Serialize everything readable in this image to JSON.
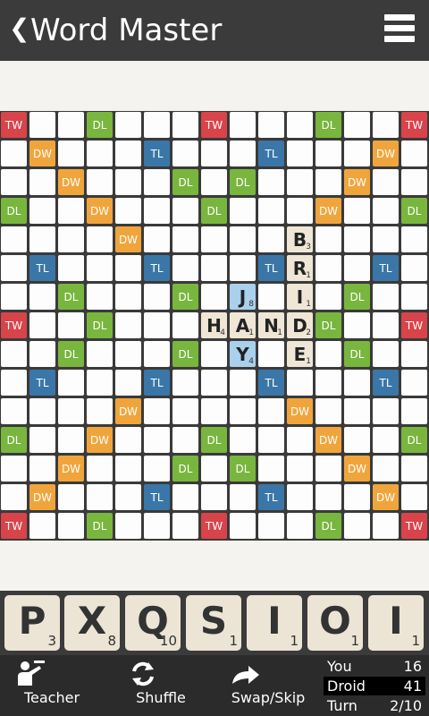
{
  "header": {
    "back_glyph": "❮",
    "title": "Word Master",
    "menu_icon": "hamburger-icon"
  },
  "board": {
    "size": 15,
    "premiums": {
      "TW": [
        [
          0,
          0
        ],
        [
          0,
          7
        ],
        [
          0,
          14
        ],
        [
          7,
          0
        ],
        [
          7,
          14
        ],
        [
          14,
          0
        ],
        [
          14,
          7
        ],
        [
          14,
          14
        ]
      ],
      "DW": [
        [
          1,
          1
        ],
        [
          1,
          13
        ],
        [
          2,
          2
        ],
        [
          2,
          12
        ],
        [
          3,
          3
        ],
        [
          3,
          11
        ],
        [
          4,
          4
        ],
        [
          4,
          10
        ],
        [
          10,
          4
        ],
        [
          10,
          10
        ],
        [
          11,
          3
        ],
        [
          11,
          11
        ],
        [
          12,
          2
        ],
        [
          12,
          12
        ],
        [
          13,
          1
        ],
        [
          13,
          13
        ]
      ],
      "DL": [
        [
          0,
          3
        ],
        [
          0,
          11
        ],
        [
          2,
          6
        ],
        [
          2,
          8
        ],
        [
          3,
          0
        ],
        [
          3,
          7
        ],
        [
          3,
          14
        ],
        [
          6,
          2
        ],
        [
          6,
          6
        ],
        [
          6,
          12
        ],
        [
          7,
          3
        ],
        [
          7,
          11
        ],
        [
          8,
          2
        ],
        [
          8,
          6
        ],
        [
          8,
          12
        ],
        [
          11,
          0
        ],
        [
          11,
          7
        ],
        [
          11,
          14
        ],
        [
          12,
          6
        ],
        [
          12,
          8
        ],
        [
          14,
          3
        ],
        [
          14,
          11
        ]
      ],
      "TL": [
        [
          1,
          5
        ],
        [
          1,
          9
        ],
        [
          5,
          1
        ],
        [
          5,
          5
        ],
        [
          5,
          9
        ],
        [
          5,
          13
        ],
        [
          9,
          1
        ],
        [
          9,
          5
        ],
        [
          9,
          9
        ],
        [
          9,
          13
        ],
        [
          13,
          5
        ],
        [
          13,
          9
        ]
      ]
    },
    "tiles": [
      {
        "r": 4,
        "c": 10,
        "letter": "B",
        "value": "3",
        "new": false
      },
      {
        "r": 5,
        "c": 10,
        "letter": "R",
        "value": "1",
        "new": false
      },
      {
        "r": 6,
        "c": 10,
        "letter": "I",
        "value": "1",
        "new": false
      },
      {
        "r": 7,
        "c": 10,
        "letter": "D",
        "value": "2",
        "new": false
      },
      {
        "r": 8,
        "c": 10,
        "letter": "E",
        "value": "1",
        "new": false
      },
      {
        "r": 7,
        "c": 7,
        "letter": "H",
        "value": "4",
        "new": false
      },
      {
        "r": 7,
        "c": 8,
        "letter": "A",
        "value": "1",
        "new": false
      },
      {
        "r": 7,
        "c": 9,
        "letter": "N",
        "value": "1",
        "new": false
      },
      {
        "r": 6,
        "c": 8,
        "letter": "J",
        "value": "8",
        "new": true
      },
      {
        "r": 8,
        "c": 8,
        "letter": "Y",
        "value": "4",
        "new": true
      }
    ]
  },
  "rack": [
    {
      "letter": "P",
      "value": "3"
    },
    {
      "letter": "X",
      "value": "8"
    },
    {
      "letter": "Q",
      "value": "10"
    },
    {
      "letter": "S",
      "value": "1"
    },
    {
      "letter": "I",
      "value": "1"
    },
    {
      "letter": "O",
      "value": "1"
    },
    {
      "letter": "I",
      "value": "1"
    }
  ],
  "toolbar": {
    "teacher": "Teacher",
    "shuffle": "Shuffle",
    "swap": "Swap/Skip"
  },
  "scoreboard": {
    "rows": [
      {
        "name": "You",
        "value": "16",
        "active": false
      },
      {
        "name": "Droid",
        "value": "41",
        "active": true
      },
      {
        "name": "Turn",
        "value": "2/10",
        "active": false
      }
    ]
  },
  "colors": {
    "TW": "#d9434a",
    "DW": "#f0a53c",
    "DL": "#78b63e",
    "TL": "#3a77a8"
  }
}
